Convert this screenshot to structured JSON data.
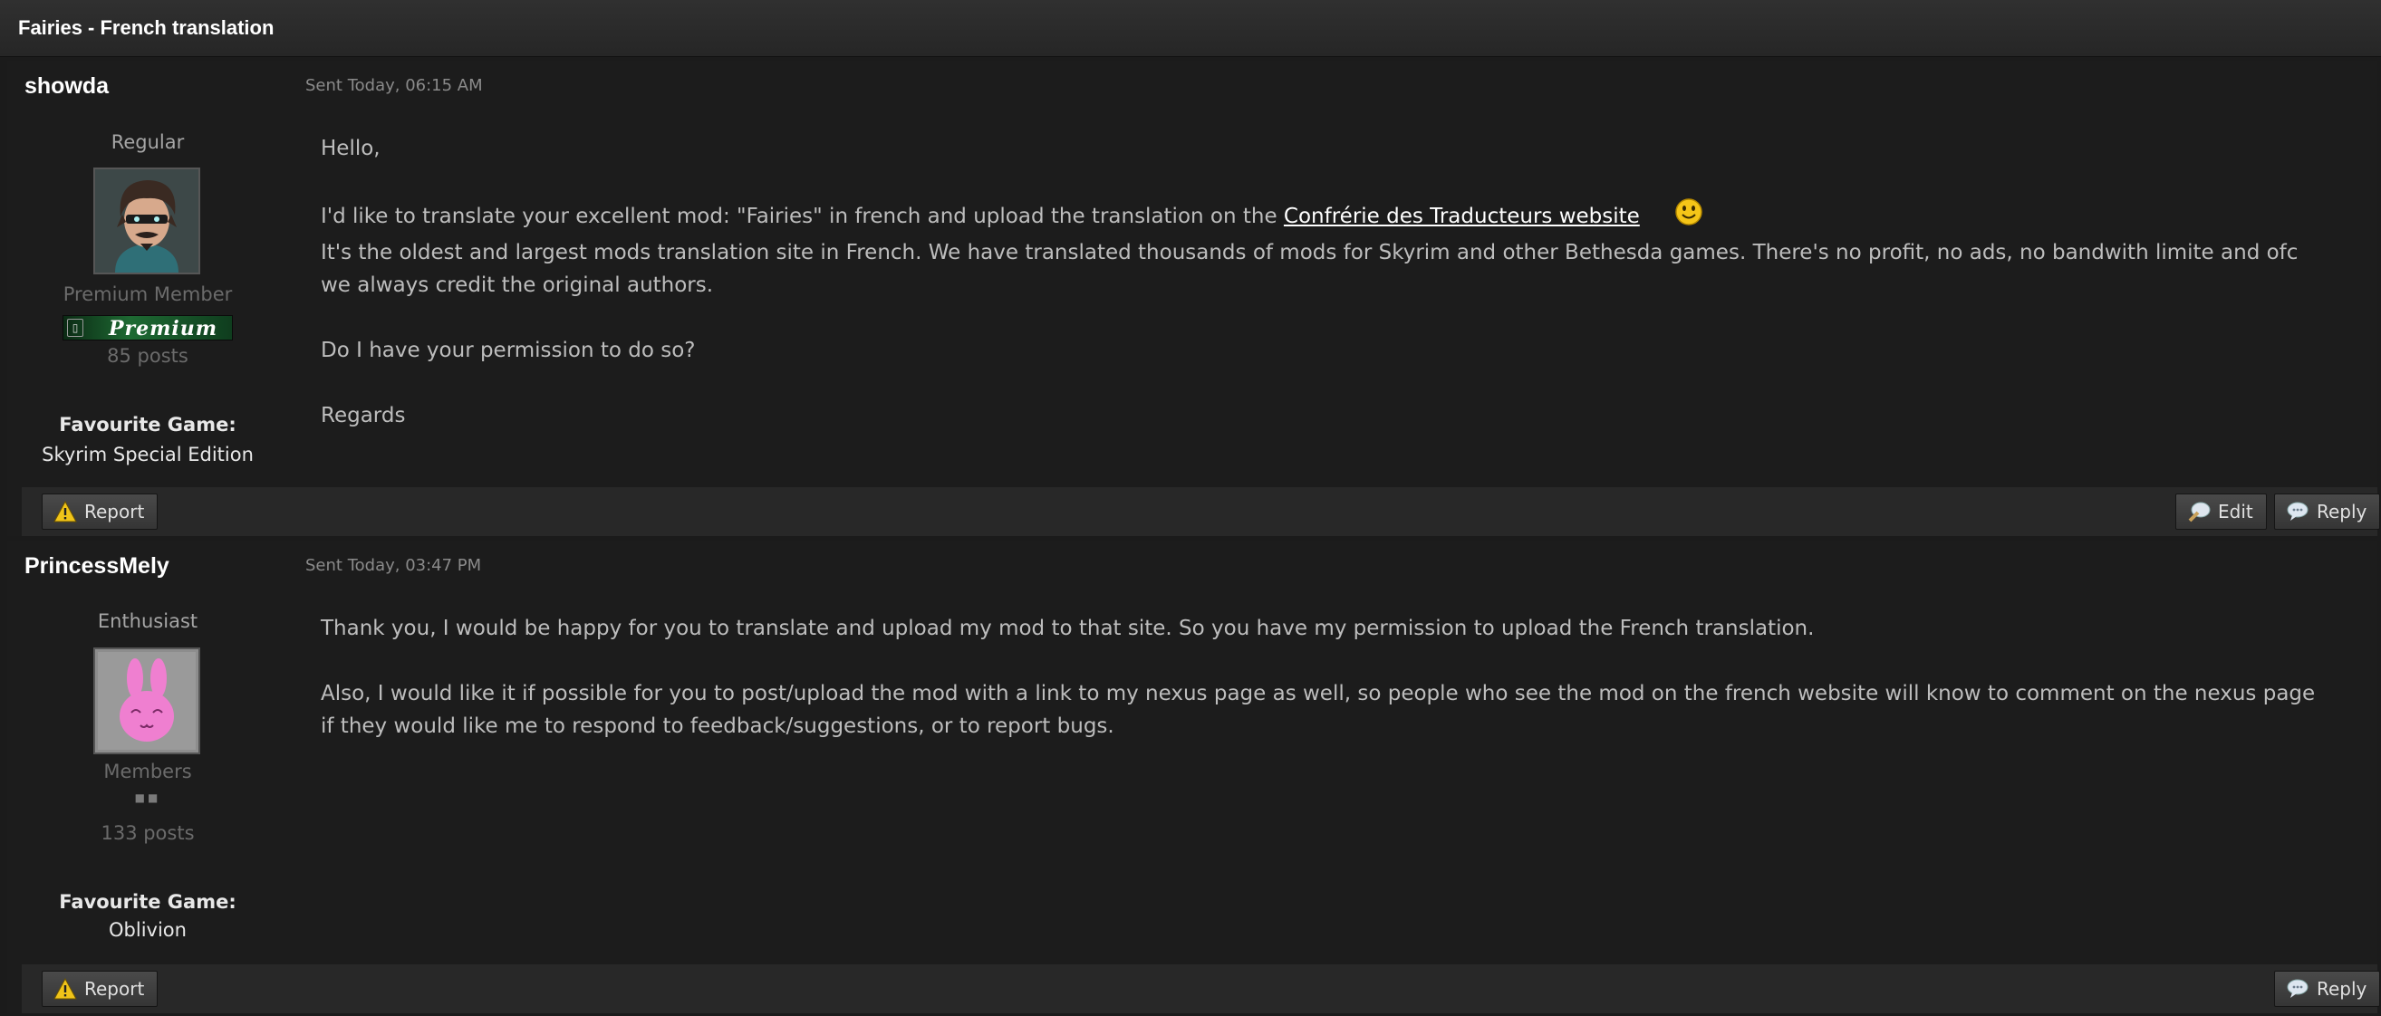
{
  "thread": {
    "title": "Fairies - French translation"
  },
  "posts": [
    {
      "author": "showda",
      "sent": "Sent Today, 06:15 AM",
      "rank": "Regular",
      "group": "Premium Member",
      "badge": "Premium",
      "post_count": "85 posts",
      "favourite_label": "Favourite Game:",
      "favourite_game": "Skyrim Special Edition",
      "body": {
        "greeting": "Hello,",
        "line1": "I'd like to translate your excellent mod: \"Fairies\" in french and upload the translation on the ",
        "link": "Confrérie des Traducteurs website",
        "line2": "It's the oldest and largest mods translation site in French. We have translated thousands of mods for Skyrim and other Bethesda games. There's no profit, no ads, no bandwith limite and ofc we always credit the original authors.",
        "line3": "Do I have your permission to do so?",
        "closing": "Regards"
      },
      "actions": {
        "report": "Report",
        "edit": "Edit",
        "reply": "Reply"
      }
    },
    {
      "author": "PrincessMely",
      "sent": "Sent Today, 03:47 PM",
      "rank": "Enthusiast",
      "group": "Members",
      "post_count": "133 posts",
      "favourite_label": "Favourite Game:",
      "favourite_game": "Oblivion",
      "body": {
        "para1": "Thank you, I would be happy for you to translate and upload my mod to that site. So you have my permission to upload the French translation.",
        "para2": "Also, I would like it if possible for you to post/upload the mod with a link to my nexus page as well, so people who see the mod on the french website will know to comment on the nexus page if they would like me to respond to feedback/suggestions, or to report bugs."
      },
      "actions": {
        "report": "Report",
        "reply": "Reply"
      }
    }
  ],
  "colors": {
    "background": "#1b1b1b",
    "text": "#bdbdbd",
    "link": "#ffffff",
    "footer": "#282828"
  }
}
